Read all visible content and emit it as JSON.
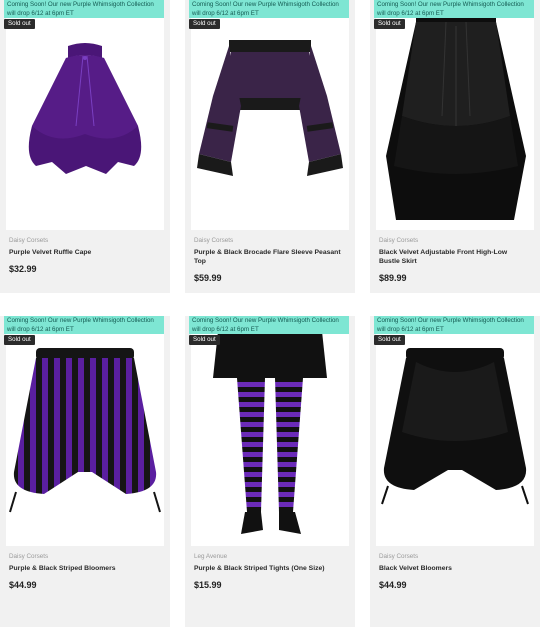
{
  "products": [
    {
      "banner": "Coming Soon! Our new Purple Whimsigoth Collection will drop 6/12 at 6pm ET",
      "badge": "Sold out",
      "brand": "Daisy Corsets",
      "title": "Purple Velvet Ruffle Cape",
      "price": "$32.99",
      "colors": {
        "main": "#4a1677",
        "accent": "#6a2fa0"
      }
    },
    {
      "banner": "Coming Soon! Our new Purple Whimsigoth Collection will drop 6/12 at 6pm ET",
      "badge": "Sold out",
      "brand": "Daisy Corsets",
      "title": "Purple & Black Brocade Flare Sleeve Peasant Top",
      "price": "$59.99",
      "colors": {
        "main": "#3a2448",
        "accent": "#1a1a1a"
      }
    },
    {
      "banner": "Coming Soon! Our new Purple Whimsigoth Collection will drop 6/12 at 6pm ET",
      "badge": "Sold out",
      "brand": "Daisy Corsets",
      "title": "Black Velvet Adjustable Front High-Low Bustle Skirt",
      "price": "$89.99",
      "colors": {
        "main": "#0d0d0d",
        "accent": "#2a2a2a"
      }
    },
    {
      "banner": "Coming Soon! Our new Purple Whimsigoth Collection will drop 6/12 at 6pm ET",
      "badge": "Sold out",
      "brand": "Daisy Corsets",
      "title": "Purple & Black Striped Bloomers",
      "price": "$44.99",
      "colors": {
        "main": "#5a1fa0",
        "accent": "#151515"
      }
    },
    {
      "banner": "Coming Soon! Our new Purple Whimsigoth Collection will drop 6/12 at 6pm ET",
      "badge": "Sold out",
      "brand": "Leg Avenue",
      "title": "Purple & Black Striped Tights (One Size)",
      "price": "$15.99",
      "colors": {
        "main": "#6b2bb8",
        "accent": "#111111"
      }
    },
    {
      "banner": "Coming Soon! Our new Purple Whimsigoth Collection will drop 6/12 at 6pm ET",
      "badge": "Sold out",
      "brand": "Daisy Corsets",
      "title": "Black Velvet Bloomers",
      "price": "$44.99",
      "colors": {
        "main": "#0f0f0f",
        "accent": "#2b2b2b"
      }
    }
  ]
}
